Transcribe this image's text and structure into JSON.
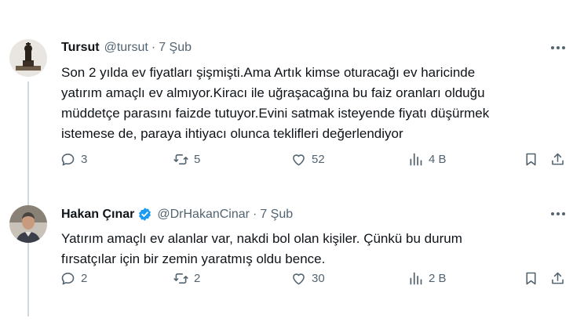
{
  "tweets": [
    {
      "name": "Tursut",
      "handle": "@tursut",
      "date": "7 Şub",
      "verified": false,
      "avatar_icon": "chess-piece-avatar",
      "lines": [
        "Son 2 yılda ev fiyatları şişmişti.Ama Artık kimse oturacağı ev haricinde",
        "yatırım amaçlı ev almıyor.Kiracı ile uğraşacağına bu faiz oranları olduğu",
        "müddetçe parasını faizde tutuyor.Evini satmak isteyende fiyatı düşürmek",
        "istemese de, paraya ihtiyacı olunca teklifleri değerlendiyor"
      ],
      "replies": "3",
      "retweets": "5",
      "likes": "52",
      "views": "4 B"
    },
    {
      "name": "Hakan Çınar",
      "handle": "@DrHakanCinar",
      "date": "7 Şub",
      "verified": true,
      "avatar_icon": "person-photo-avatar",
      "lines": [
        "Yatırım amaçlı ev alanlar var, nakdi bol olan kişiler. Çünkü bu durum",
        "fırsatçılar için bir zemin yaratmış oldu bence."
      ],
      "replies": "2",
      "retweets": "2",
      "likes": "30",
      "views": "2 B"
    }
  ],
  "separator": "·",
  "colors": {
    "text": "#0f1419",
    "muted": "#536471",
    "verified_blue": "#1d9bf0",
    "thread_line": "#cfd9de"
  }
}
